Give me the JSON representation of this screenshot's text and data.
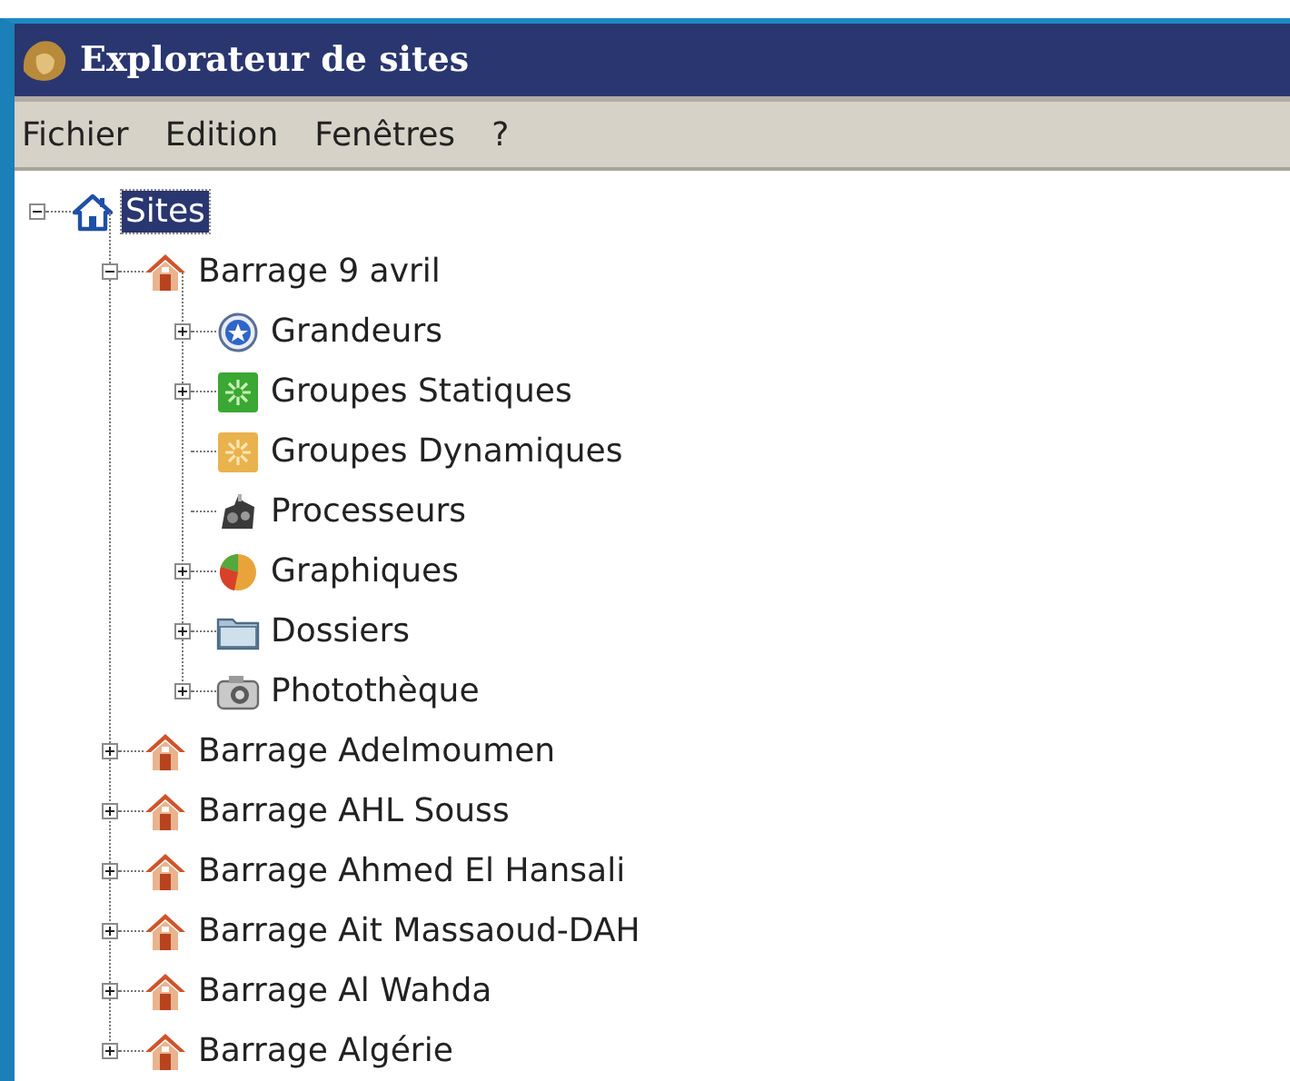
{
  "window": {
    "title": "Explorateur de sites"
  },
  "menu": [
    "Fichier",
    "Edition",
    "Fenêtres",
    "?"
  ],
  "tree": [
    {
      "label": "Sites",
      "kind": "home",
      "expanded": true,
      "selected": true,
      "children": [
        {
          "label": "Barrage 9 avril",
          "kind": "dam",
          "expanded": true,
          "selected": false,
          "children": [
            {
              "label": "Grandeurs",
              "kind": "star",
              "expanded": false,
              "selected": false
            },
            {
              "label": "Groupes Statiques",
              "kind": "green-group",
              "expanded": false,
              "selected": false
            },
            {
              "label": "Groupes Dynamiques",
              "kind": "orange-group",
              "leaf": true,
              "selected": false
            },
            {
              "label": "Processeurs",
              "kind": "processor",
              "leaf": true,
              "selected": false
            },
            {
              "label": "Graphiques",
              "kind": "pie",
              "expanded": false,
              "selected": false
            },
            {
              "label": "Dossiers",
              "kind": "folder",
              "expanded": false,
              "selected": false
            },
            {
              "label": "Photothèque",
              "kind": "camera",
              "expanded": false,
              "selected": false
            }
          ]
        },
        {
          "label": "Barrage Adelmoumen",
          "kind": "dam",
          "expanded": false,
          "selected": false
        },
        {
          "label": "Barrage AHL Souss",
          "kind": "dam",
          "expanded": false,
          "selected": false
        },
        {
          "label": "Barrage Ahmed El Hansali",
          "kind": "dam",
          "expanded": false,
          "selected": false
        },
        {
          "label": "Barrage Ait Massaoud-DAH",
          "kind": "dam",
          "expanded": false,
          "selected": false
        },
        {
          "label": "Barrage Al Wahda",
          "kind": "dam",
          "expanded": false,
          "selected": false
        },
        {
          "label": "Barrage Algérie",
          "kind": "dam",
          "expanded": false,
          "selected": false
        }
      ]
    }
  ]
}
